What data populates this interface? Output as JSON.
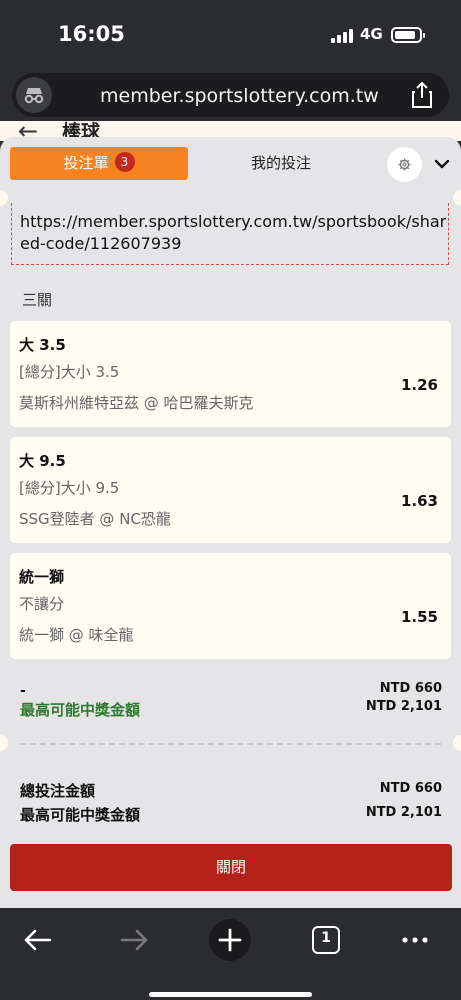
{
  "status": {
    "time": "16:05",
    "network": "4G"
  },
  "browser": {
    "url": "member.sportslottery.com.tw"
  },
  "page": {
    "back_symbol": "←",
    "title": "棒球"
  },
  "tabs": {
    "active_label": "投注單",
    "badge_count": "3",
    "inactive_label": "我的投注"
  },
  "shared": {
    "link": "https://member.sportslottery.com.tw/sportsbook/shared-code/112607939"
  },
  "section_label": "三關",
  "bets": [
    {
      "title": "大 3.5",
      "market": "[總分]大小 3.5",
      "match": "莫斯科州維特亞茲 @ 哈巴羅夫斯克",
      "odds": "1.26"
    },
    {
      "title": "大 9.5",
      "market": "[總分]大小 9.5",
      "match": "SSG登陸者 @ NC恐龍",
      "odds": "1.63"
    },
    {
      "title": "統一獅",
      "market": "不讓分",
      "match": "統一獅 @ 味全龍",
      "odds": "1.55"
    }
  ],
  "summary": {
    "dash": "-",
    "stake": "NTD 660",
    "win_label": "最高可能中獎金額",
    "win_amount": "NTD 2,101"
  },
  "totals": {
    "total_label": "總投注金額",
    "total_amount": "NTD 660",
    "max_label": "最高可能中獎金額",
    "max_amount": "NTD 2,101"
  },
  "close_label": "關閉",
  "bottom_nav": {
    "tab_count": "1"
  },
  "colors": {
    "accent": "#f5831f",
    "badge": "#c5281c",
    "close": "#b4231a",
    "win_green": "#2c7a2c"
  }
}
